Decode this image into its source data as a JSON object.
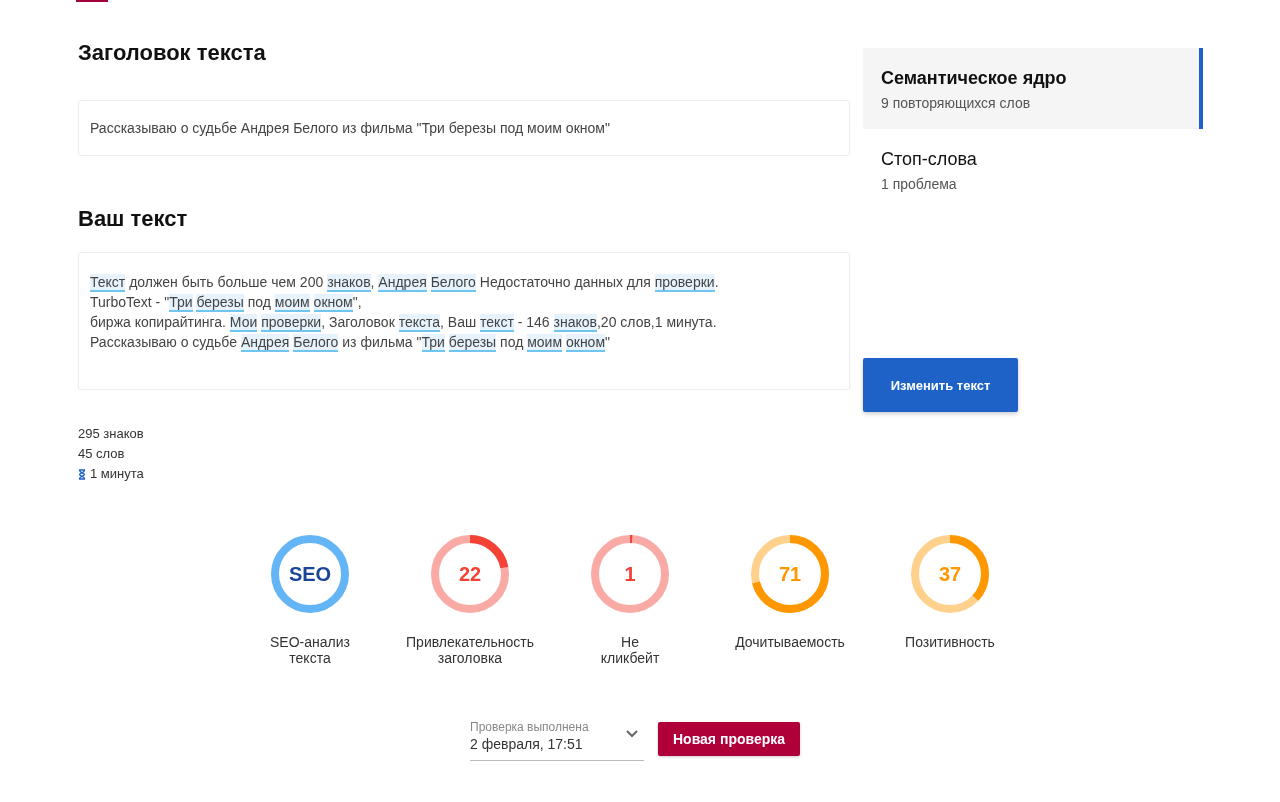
{
  "title_section": {
    "heading": "Заголовок текста",
    "value": "Рассказываю о судьбе Андрея Белого из фильма \"Три березы под моим окном\""
  },
  "text_section": {
    "heading": "Ваш текст",
    "lines": [
      [
        {
          "text": "Текст",
          "highlighted": true,
          "space_after": false
        },
        {
          "text": " должен быть больше чем 200 ",
          "highlighted": false
        },
        {
          "text": "знаков",
          "highlighted": true,
          "space_after": false
        },
        {
          "text": ", ",
          "highlighted": false
        },
        {
          "text": "Андрея",
          "highlighted": true,
          "space_after": true
        },
        {
          "text": "Белого",
          "highlighted": true,
          "space_after": false
        },
        {
          "text": " Недостаточно данных для ",
          "highlighted": false
        },
        {
          "text": "проверки",
          "highlighted": true,
          "space_after": false
        },
        {
          "text": ".",
          "highlighted": false
        }
      ],
      [
        {
          "text": "TurboText - \"",
          "highlighted": false
        },
        {
          "text": "Три",
          "highlighted": true,
          "space_after": true
        },
        {
          "text": "березы",
          "highlighted": true,
          "space_after": false
        },
        {
          "text": " под ",
          "highlighted": false
        },
        {
          "text": "моим",
          "highlighted": true,
          "space_after": true
        },
        {
          "text": "окном",
          "highlighted": true,
          "space_after": false
        },
        {
          "text": "\",",
          "highlighted": false
        }
      ],
      [
        {
          "text": "биржа копирайтинга. ",
          "highlighted": false
        },
        {
          "text": "Мои",
          "highlighted": true,
          "space_after": true
        },
        {
          "text": "проверки",
          "highlighted": true,
          "space_after": false
        },
        {
          "text": ", Заголовок ",
          "highlighted": false
        },
        {
          "text": "текста",
          "highlighted": true,
          "space_after": false
        },
        {
          "text": ", Ваш ",
          "highlighted": false
        },
        {
          "text": "текст",
          "highlighted": true,
          "space_after": false
        },
        {
          "text": " - 146 ",
          "highlighted": false
        },
        {
          "text": "знаков",
          "highlighted": true,
          "space_after": false
        },
        {
          "text": ",20 слов,1 минута.",
          "highlighted": false
        }
      ],
      [
        {
          "text": "Рассказываю о судьбе ",
          "highlighted": false
        },
        {
          "text": "Андрея",
          "highlighted": true,
          "space_after": true
        },
        {
          "text": "Белого",
          "highlighted": true,
          "space_after": false
        },
        {
          "text": " из фильма \"",
          "highlighted": false
        },
        {
          "text": "Три",
          "highlighted": true,
          "space_after": true
        },
        {
          "text": "березы",
          "highlighted": true,
          "space_after": false
        },
        {
          "text": " под ",
          "highlighted": false
        },
        {
          "text": "моим",
          "highlighted": true,
          "space_after": true
        },
        {
          "text": "окном",
          "highlighted": true,
          "space_after": false
        },
        {
          "text": "\"",
          "highlighted": false
        }
      ]
    ]
  },
  "stats": {
    "chars": "295 знаков",
    "words": "45 слов",
    "reading_time": "1 минута"
  },
  "sidebar": {
    "items": [
      {
        "title": "Семантическое ядро",
        "subtitle": "9 повторяющихся слов",
        "selected": true
      },
      {
        "title": "Стоп-слова",
        "subtitle": "1 проблема",
        "selected": false
      }
    ]
  },
  "edit_button": "Изменить текст",
  "gauges": [
    {
      "kind": "badge",
      "value": "SEO",
      "label": "SEO-анализ текста",
      "color": "#64b5f6"
    },
    {
      "kind": "score",
      "value": "22",
      "label": "Привлекательность заголовка",
      "level": 0.22,
      "color": "#f44336"
    },
    {
      "kind": "score",
      "value": "1",
      "label": "Не кликбейт",
      "level": 0.01,
      "color": "#f44336"
    },
    {
      "kind": "score",
      "value": "71",
      "label": "Дочитываемость",
      "level": 0.71,
      "color": "#ff9800"
    },
    {
      "kind": "score",
      "value": "37",
      "label": "Позитивность",
      "level": 0.37,
      "color": "#ff9800"
    }
  ],
  "check_select": {
    "label": "Проверка выполнена",
    "value": "2 февраля, 17:51"
  },
  "new_check_button": "Новая проверка"
}
